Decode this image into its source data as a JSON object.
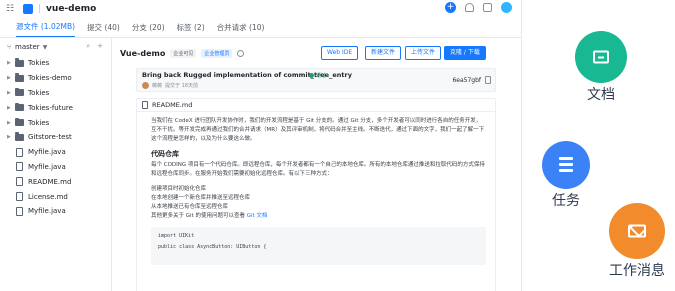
{
  "topbar": {
    "repo_title": "vue-demo",
    "separator": "|"
  },
  "tabs": [
    {
      "label": "源文件 (1.02MB)"
    },
    {
      "label": "提交 (40)"
    },
    {
      "label": "分支 (20)"
    },
    {
      "label": "标签 (2)"
    },
    {
      "label": "合并请求 (10)"
    }
  ],
  "sidebar": {
    "branch": "master",
    "items": [
      {
        "label": "Tokies",
        "type": "folder"
      },
      {
        "label": "Tokies-demo",
        "type": "folder"
      },
      {
        "label": "Tokies",
        "type": "folder"
      },
      {
        "label": "Tokies-future",
        "type": "folder"
      },
      {
        "label": "Tokies",
        "type": "folder"
      },
      {
        "label": "Gitstore-test",
        "type": "folder"
      },
      {
        "label": "Myfile.java",
        "type": "file"
      },
      {
        "label": "Myfile.java",
        "type": "file"
      },
      {
        "label": "README.md",
        "type": "file"
      },
      {
        "label": "License.md",
        "type": "file"
      },
      {
        "label": "Myfile.java",
        "type": "file"
      }
    ]
  },
  "main": {
    "repo_name": "Vue-demo",
    "badge_public": "企业可见",
    "badge_enterprise": "企业管理员",
    "web_ide": "Web IDE",
    "new_file": "新建文件",
    "upload_file": "上传文件",
    "clone": "克隆 / 下载",
    "commit": {
      "message": "Bring back Rugged implementation of commit_tree_entry",
      "status": "通过",
      "author": "薇薇",
      "time": "提交于 18天前",
      "sha": "6ea57gbf"
    },
    "readme": {
      "filename": "README.md",
      "intro": "当我们在 CodeX 进行团队开发协作时，我们的开发流程是基于 Git 分支的。通过 Git 分支，多个开发者可以同时进行各自的任务开发，互不干扰。等开发完成再通过我们的合并请求（MR）及其评审机制，将代码合并至主线。不断迭代，通过下面的文字，我们一起了解一下这个流程是怎样的，以及为什么要这么做。",
      "heading": "代码仓库",
      "para": "每个 CODING 项目有一个代码仓库。即远程仓库，每个开发者都有一个自己的本地仓库。所有的本地仓库通过推送和拉取代码的方式保持和远程仓库同步。在服务开始我们需要初始化远程仓库。有以下三种方式：",
      "steps": [
        "创建项目时初始化仓库",
        "在本地创建一个新仓库并推送至远程仓库",
        "从本地推送已有仓库至远程仓库",
        "其他更多关于 Git 的使用问题可以查看"
      ],
      "link": "Git 文档",
      "code": [
        "import UIKit",
        "public class AsyncButton: UIButton {"
      ]
    }
  },
  "floating": {
    "docs": {
      "label": "文档",
      "color": "#18b892"
    },
    "tasks": {
      "label": "任务",
      "color": "#3b82f6"
    },
    "messages": {
      "label": "工作消息",
      "color": "#f28b2c"
    }
  }
}
